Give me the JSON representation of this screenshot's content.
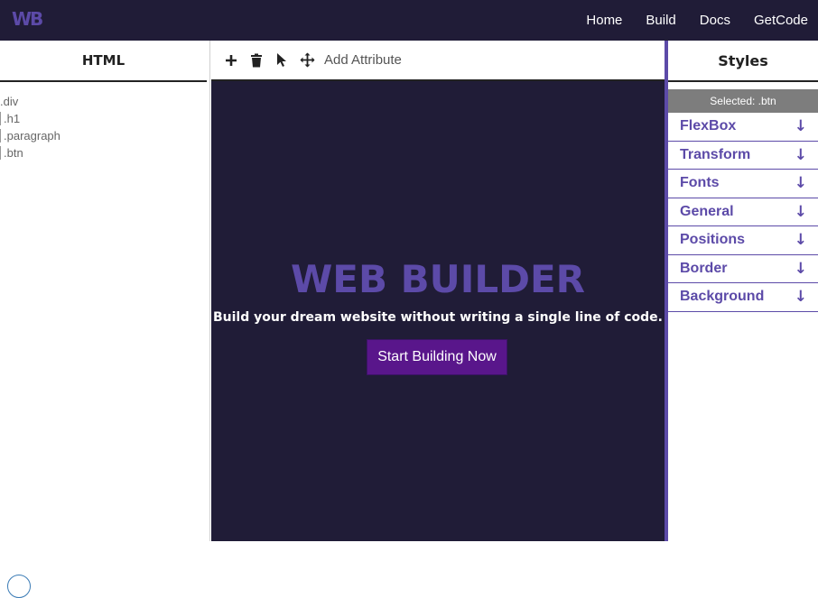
{
  "header": {
    "logo": "WB",
    "nav": [
      "Home",
      "Build",
      "Docs",
      "GetCode"
    ]
  },
  "left_panel": {
    "title": "HTML",
    "tree": [
      {
        "label": ".div",
        "child": false
      },
      {
        "label": ".h1",
        "child": true
      },
      {
        "label": ".paragraph",
        "child": true
      },
      {
        "label": ".btn",
        "child": true
      }
    ]
  },
  "toolbar": {
    "icons": [
      "plus-icon",
      "trash-icon",
      "pointer-icon",
      "move-icon"
    ],
    "add_attribute": "Add Attribute"
  },
  "canvas": {
    "title": "WEB BUILDER",
    "subtitle": "Build your dream website without writing a single line of code.",
    "button": "Start Building Now"
  },
  "right_panel": {
    "title": "Styles",
    "selected": "Selected: .btn",
    "items": [
      "FlexBox",
      "Transform",
      "Fonts",
      "General",
      "Positions",
      "Border",
      "Background"
    ]
  },
  "colors": {
    "nav_bg": "#201c37",
    "accent": "#5c4aa8",
    "button_bg": "#59168b",
    "selected_bg": "#7d7d7d"
  }
}
